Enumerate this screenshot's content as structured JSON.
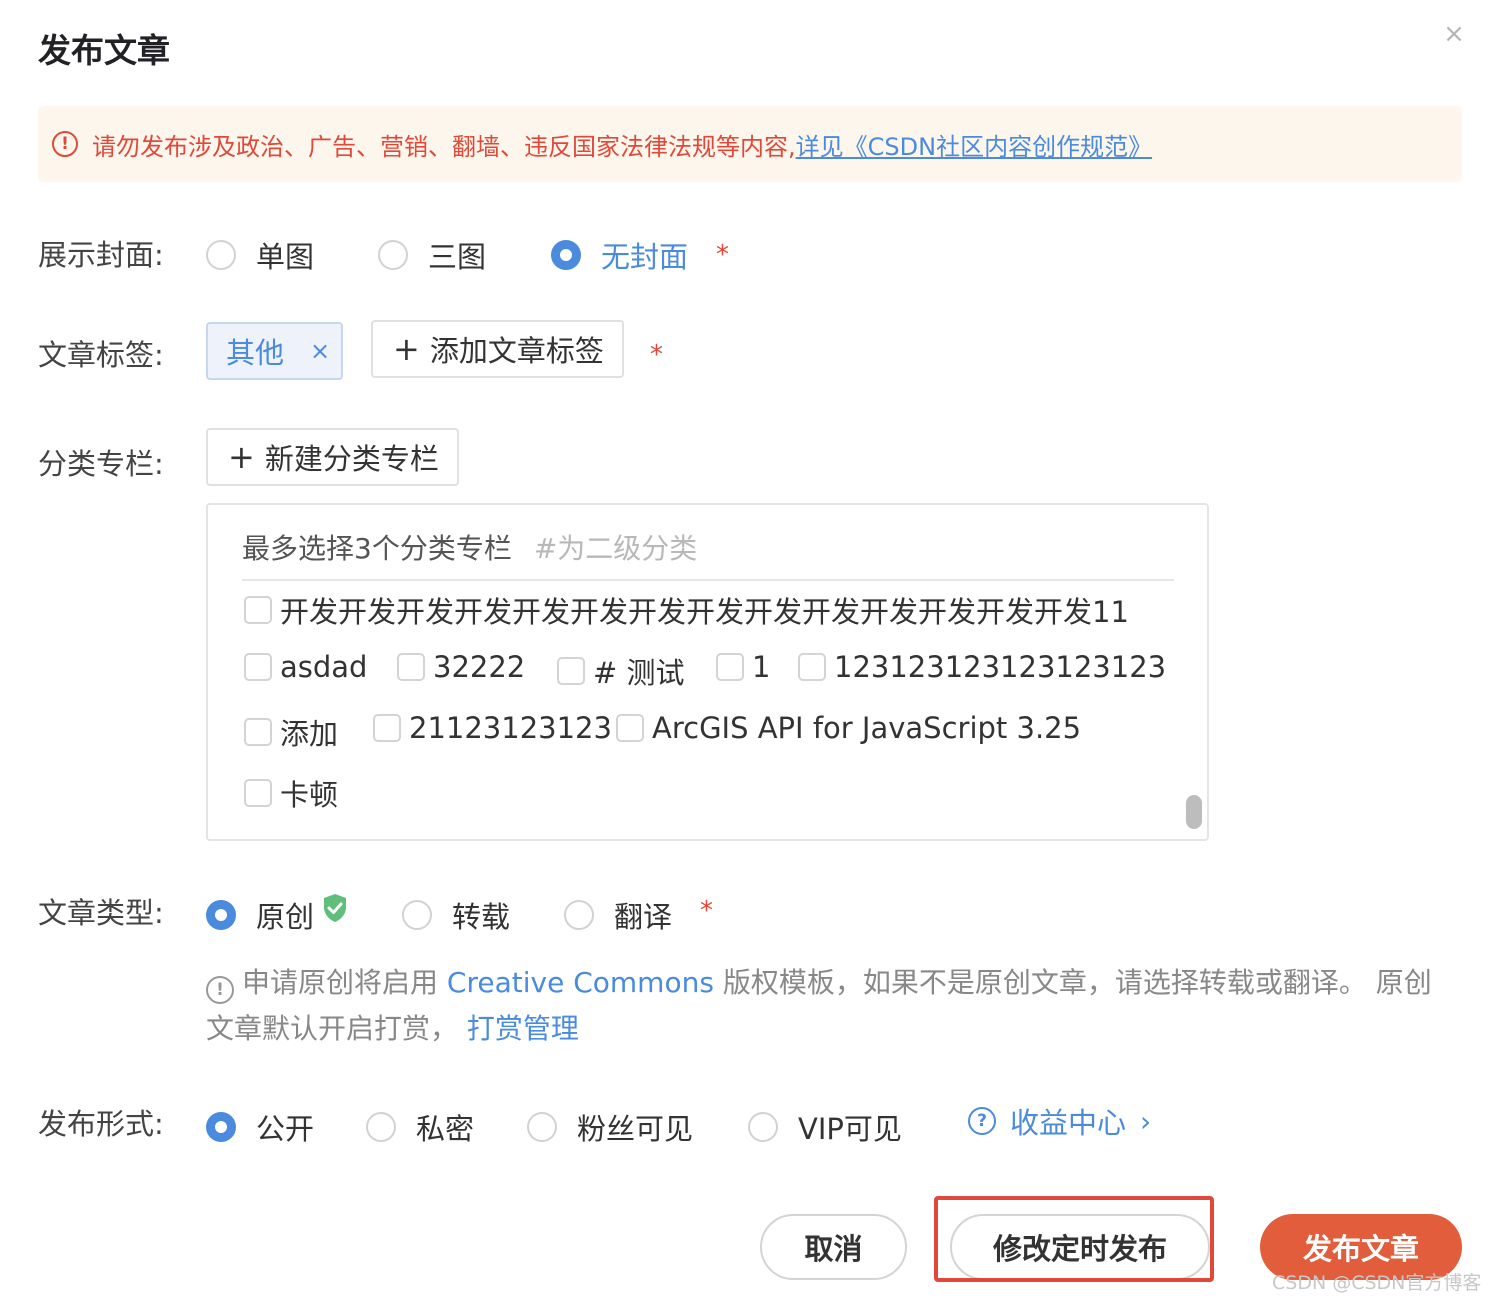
{
  "dialog": {
    "title": "发布文章",
    "close_icon": "×"
  },
  "notice": {
    "icon": "!",
    "text": "请勿发布涉及政治、广告、营销、翻墙、违反国家法律法规等内容,",
    "link": "详见《CSDN社区内容创作规范》"
  },
  "cover": {
    "label": "展示封面:",
    "options": [
      "单图",
      "三图",
      "无封面"
    ],
    "selected": "无封面",
    "required": "*"
  },
  "tags": {
    "label": "文章标签:",
    "items": [
      {
        "text": "其他",
        "remove": "×"
      }
    ],
    "add_button": "添加文章标签",
    "plus": "+",
    "required": "*"
  },
  "category": {
    "label": "分类专栏:",
    "new_button": "新建分类专栏",
    "plus": "+",
    "header": "最多选择3个分类专栏",
    "hint": "#为二级分类",
    "options": [
      "开发开发开发开发开发开发开发开发开发开发开发开发开发开发11",
      "asdad",
      "32222",
      "# 测试",
      "1",
      "123123123123123123",
      "添加",
      "21123123123",
      "ArcGIS API for JavaScript 3.25",
      "卡顿"
    ]
  },
  "article_type": {
    "label": "文章类型:",
    "options": [
      "原创",
      "转载",
      "翻译"
    ],
    "selected": "原创",
    "required": "*",
    "info_icon": "!",
    "info_part1": "申请原创将启用",
    "info_link1": "Creative Commons",
    "info_part2": "版权模板，如果不是原创文章，请选择转载或翻译。 原创文章默认开启打赏，",
    "info_link2": "打赏管理"
  },
  "visibility": {
    "label": "发布形式:",
    "options": [
      "公开",
      "私密",
      "粉丝可见",
      "VIP可见"
    ],
    "selected": "公开",
    "help_icon": "?",
    "income_link": "收益中心",
    "chevron": "›"
  },
  "actions": {
    "cancel": "取消",
    "schedule": "修改定时发布",
    "publish": "发布文章"
  },
  "watermark": "CSDN @CSDN官方博客",
  "colors": {
    "accent": "#4a8bde",
    "primary_button": "#e25d3c",
    "warning": "#e0493a",
    "notice_bg": "#fdf6ec",
    "shield": "#5fbf7a"
  }
}
